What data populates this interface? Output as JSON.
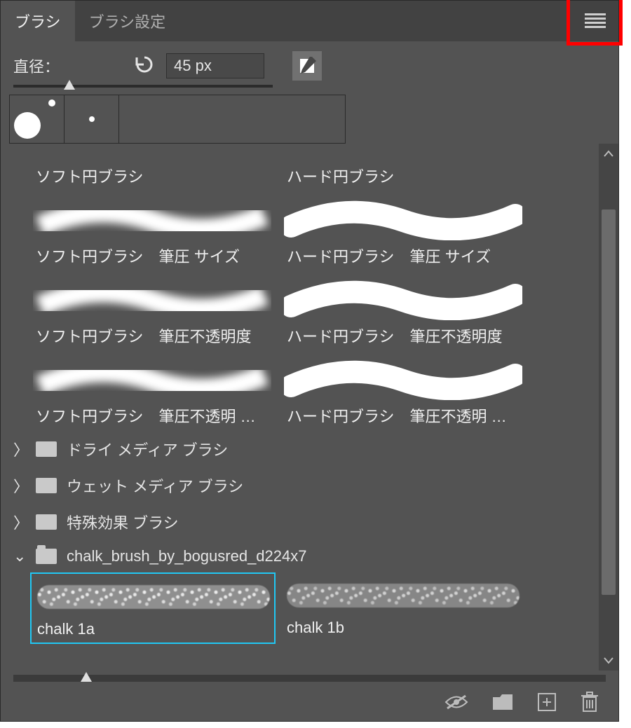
{
  "tabs": {
    "brushes": "ブラシ",
    "brush_settings": "ブラシ設定"
  },
  "size": {
    "label": "直径：",
    "value": "45 px"
  },
  "brush_grid": [
    {
      "left": "ソフト円ブラシ",
      "right": "ハード円ブラシ",
      "soft": true
    },
    {
      "left": "ソフト円ブラシ　筆圧 サイズ",
      "right": "ハード円ブラシ　筆圧 サイズ",
      "soft": true
    },
    {
      "left": "ソフト円ブラシ　筆圧不透明度",
      "right": "ハード円ブラシ　筆圧不透明度",
      "soft": true
    },
    {
      "left": "ソフト円ブラシ　筆圧不透明 …",
      "right": "ハード円ブラシ　筆圧不透明 …",
      "soft": true
    }
  ],
  "folders": {
    "dry": "ドライ メディア ブラシ",
    "wet": "ウェット メディア ブラシ",
    "fx": "特殊効果 ブラシ",
    "chalk": "chalk_brush_by_bogusred_d224x7"
  },
  "chalk": {
    "a": "chalk 1a",
    "b": "chalk 1b"
  }
}
